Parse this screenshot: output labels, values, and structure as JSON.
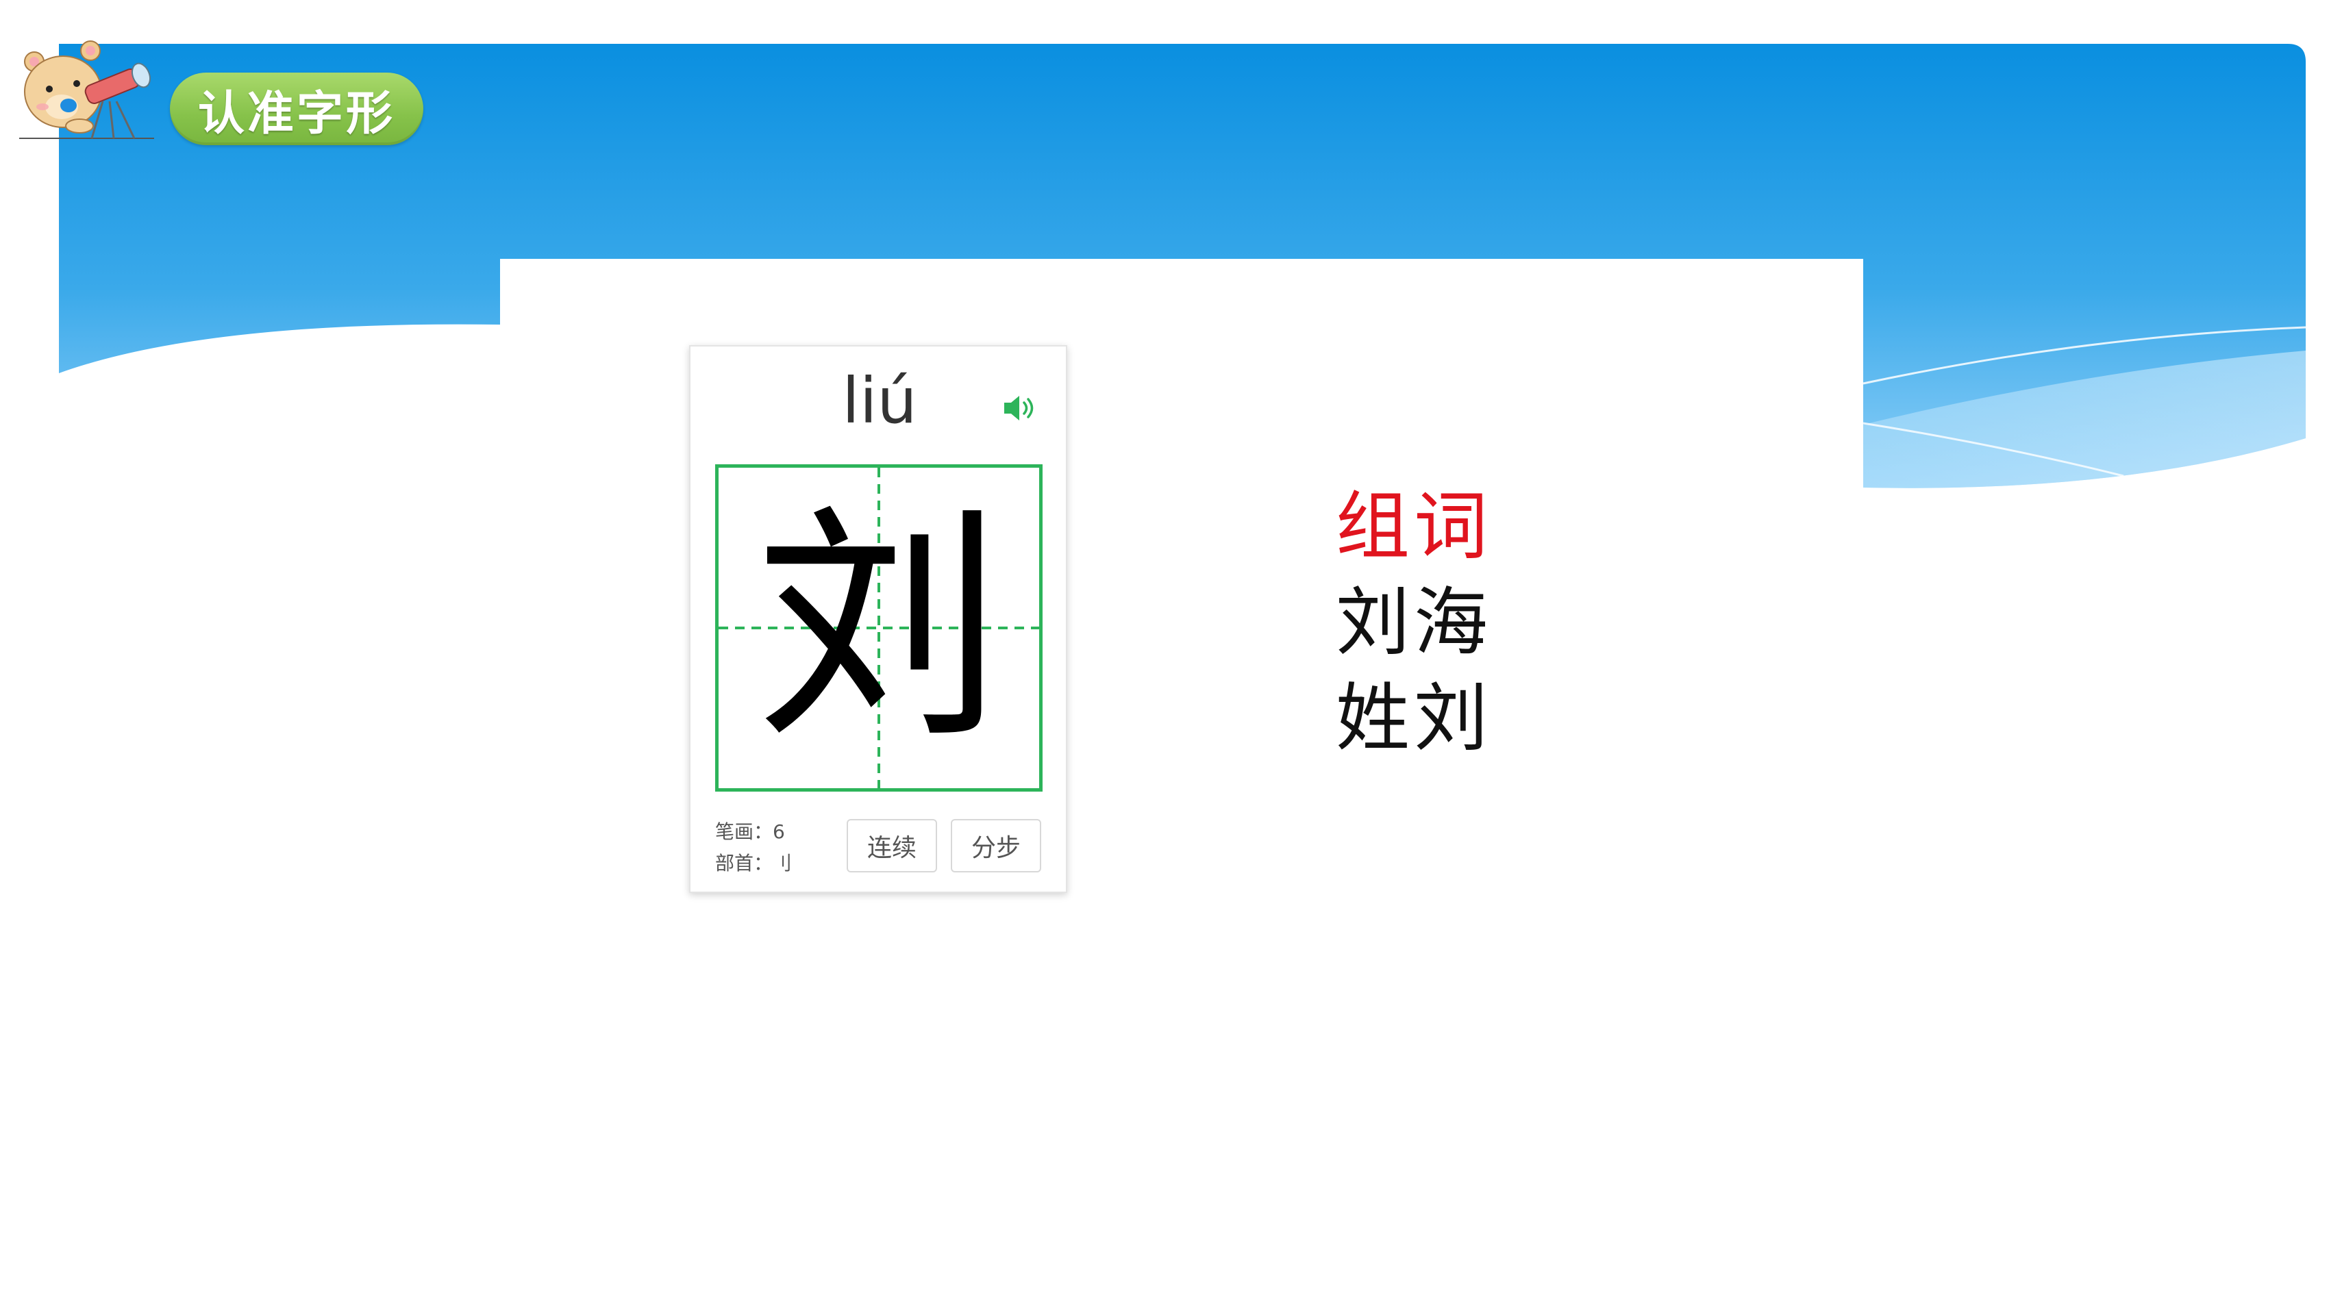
{
  "header": {
    "title": "认准字形",
    "mascot": "bear-with-telescope"
  },
  "card": {
    "pinyin": "liú",
    "speaker_icon": "speaker-icon",
    "character": "刘",
    "strokes_label": "笔画：",
    "strokes_value": "6",
    "radical_label": "部首：",
    "radical_value": "刂",
    "buttons": {
      "continuous": "连续",
      "step": "分步"
    }
  },
  "words": {
    "heading": "组词",
    "items": [
      "刘海",
      "姓刘"
    ]
  },
  "colors": {
    "sky_top": "#0a8fe0",
    "sky_bottom": "#8fd0f8",
    "pill_green": "#86c24a",
    "grid_green": "#2db45a",
    "heading_red": "#e0141e"
  }
}
